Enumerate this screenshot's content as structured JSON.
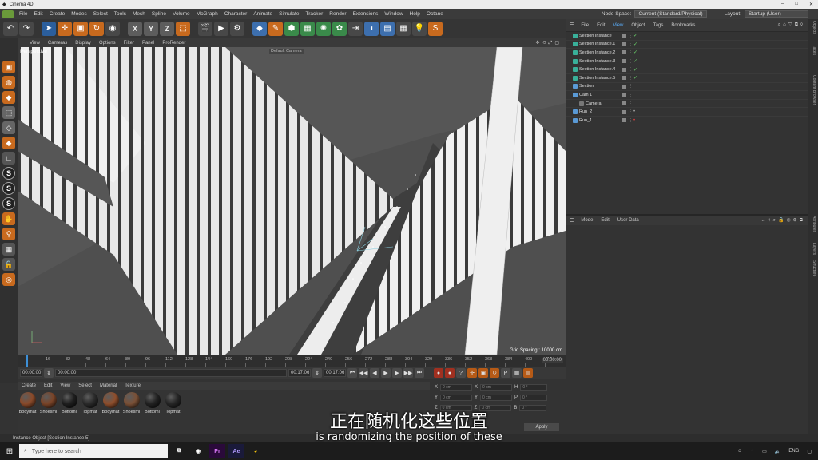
{
  "window": {
    "title": "Cinema 4D"
  },
  "menu": {
    "items": [
      "File",
      "Edit",
      "Create",
      "Modes",
      "Select",
      "Tools",
      "Mesh",
      "Spline",
      "Volume",
      "MoGraph",
      "Character",
      "Animate",
      "Simulate",
      "Tracker",
      "Render",
      "Extensions",
      "Window",
      "Help",
      "Octane"
    ],
    "node_space_label": "Node Space:",
    "node_space_value": "Current (Standard/Physical)",
    "layout_label": "Layout:",
    "layout_value": "Startup (User)"
  },
  "viewport": {
    "menu": [
      "View",
      "Cameras",
      "Display",
      "Options",
      "Filter",
      "Panel",
      "ProRender"
    ],
    "label": "Perspective",
    "camera": "Default Camera",
    "grid_spacing": "Grid Spacing : 10000 cm"
  },
  "timeline": {
    "ticks": [
      "0",
      "16",
      "32",
      "48",
      "64",
      "80",
      "96",
      "112",
      "128",
      "144",
      "160",
      "176",
      "192",
      "208",
      "224",
      "240",
      "256",
      "272",
      "288",
      "304",
      "320",
      "336",
      "352",
      "368",
      "384",
      "400",
      "416"
    ],
    "frame_end": "00:00:00"
  },
  "transport": {
    "start": "00:00:00",
    "current": "00:00:00",
    "end1": "00:17:06",
    "end2": "00:17:06"
  },
  "materials": {
    "menu": [
      "Create",
      "Edit",
      "View",
      "Select",
      "Material",
      "Texture"
    ],
    "items": [
      {
        "name": "Bodymat",
        "color": "#8a4a2a"
      },
      {
        "name": "Shoesmi",
        "color": "#7a4428"
      },
      {
        "name": "Bottoml",
        "color": "#1e1e1e"
      },
      {
        "name": "Topmat",
        "color": "#2a2a2a"
      },
      {
        "name": "Bodymat",
        "color": "#8e4e2c"
      },
      {
        "name": "Shoesmi",
        "color": "#7a5036"
      },
      {
        "name": "Bottoml",
        "color": "#222"
      },
      {
        "name": "Topmat",
        "color": "#262626"
      }
    ]
  },
  "coords": {
    "labels": [
      "X",
      "Y",
      "Z"
    ],
    "value": "0 cm",
    "right_labels": [
      "H",
      "P",
      "B"
    ],
    "right_value": "0 °",
    "apply": "Apply"
  },
  "objects": {
    "menu": [
      "File",
      "Edit",
      "View",
      "Object",
      "Tags",
      "Bookmarks"
    ],
    "rows": [
      {
        "name": "Section Instance"
      },
      {
        "name": "Section Instance.1"
      },
      {
        "name": "Section Instance.2"
      },
      {
        "name": "Section Instance.3"
      },
      {
        "name": "Section Instance.4"
      },
      {
        "name": "Section Instance.5"
      },
      {
        "name": "Section"
      },
      {
        "name": "Cam 1"
      },
      {
        "name": "Camera"
      },
      {
        "name": "Run_2"
      },
      {
        "name": "Run_1"
      }
    ]
  },
  "attributes": {
    "menu": [
      "Mode",
      "Edit",
      "User Data"
    ]
  },
  "side_tabs": [
    "Objects",
    "Takes",
    "Content Browser",
    "Attributes",
    "Layers",
    "Structure"
  ],
  "subtitle": {
    "cn": "正在随机化这些位置",
    "en": "is randomizing the position of these"
  },
  "status": "Instance Object [Section Instance.5]",
  "taskbar": {
    "search_placeholder": "Type here to search",
    "lang": "ENG"
  }
}
